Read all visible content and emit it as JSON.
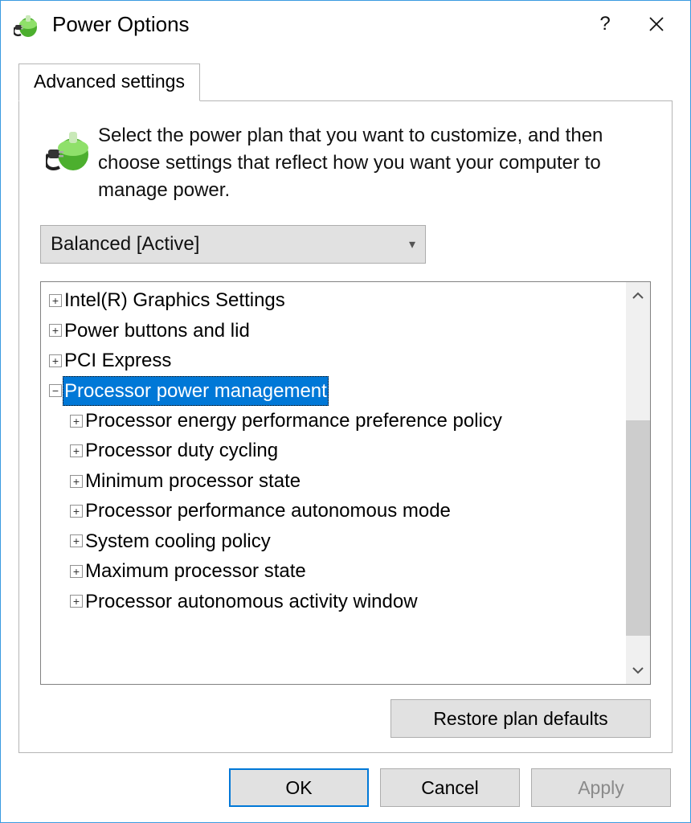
{
  "window": {
    "title": "Power Options"
  },
  "tab": {
    "label": "Advanced settings"
  },
  "description": "Select the power plan that you want to customize, and then choose settings that reflect how you want your computer to manage power.",
  "plan_combo": {
    "selected": "Balanced [Active]"
  },
  "tree": {
    "items": [
      {
        "label": "Intel(R) Graphics Settings",
        "expanded": false,
        "depth": 0,
        "selected": false
      },
      {
        "label": "Power buttons and lid",
        "expanded": false,
        "depth": 0,
        "selected": false
      },
      {
        "label": "PCI Express",
        "expanded": false,
        "depth": 0,
        "selected": false
      },
      {
        "label": "Processor power management",
        "expanded": true,
        "depth": 0,
        "selected": true
      },
      {
        "label": "Processor energy performance preference policy",
        "expanded": false,
        "depth": 1,
        "selected": false
      },
      {
        "label": "Processor duty cycling",
        "expanded": false,
        "depth": 1,
        "selected": false
      },
      {
        "label": "Minimum processor state",
        "expanded": false,
        "depth": 1,
        "selected": false
      },
      {
        "label": "Processor performance autonomous mode",
        "expanded": false,
        "depth": 1,
        "selected": false
      },
      {
        "label": "System cooling policy",
        "expanded": false,
        "depth": 1,
        "selected": false
      },
      {
        "label": "Maximum processor state",
        "expanded": false,
        "depth": 1,
        "selected": false
      },
      {
        "label": "Processor autonomous activity window",
        "expanded": false,
        "depth": 1,
        "selected": false
      }
    ]
  },
  "buttons": {
    "restore": "Restore plan defaults",
    "ok": "OK",
    "cancel": "Cancel",
    "apply": "Apply"
  }
}
